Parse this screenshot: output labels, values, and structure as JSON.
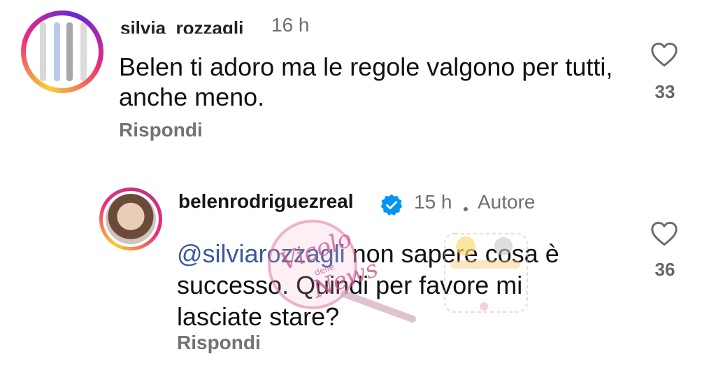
{
  "comments": [
    {
      "username": "silvia_rozzagli",
      "time": "16 h",
      "text": "Belen ti adoro ma le regole valgono per tutti, anche meno.",
      "reply_label": "Rispondi",
      "likes": "33"
    },
    {
      "username": "belenrodriguezreal",
      "time": "15 h",
      "author_badge": "Autore",
      "mention": "@silviarozzagli",
      "text": " non sapere cosa è successo. Quindi per favore mi lasciate stare?",
      "reply_label": "Rispondi",
      "likes": "36"
    }
  ],
  "watermark": {
    "line1": "Vicolo",
    "line2": "delle",
    "line3": "News"
  },
  "colors": {
    "story_ring_start": "#f9ce34",
    "story_ring_mid": "#ee2a7b",
    "verified": "#0095f6",
    "secondary_text": "#737373",
    "mention": "#3b5998"
  },
  "icons": {
    "like": "heart-outline-icon",
    "verified": "verified-badge-icon"
  }
}
